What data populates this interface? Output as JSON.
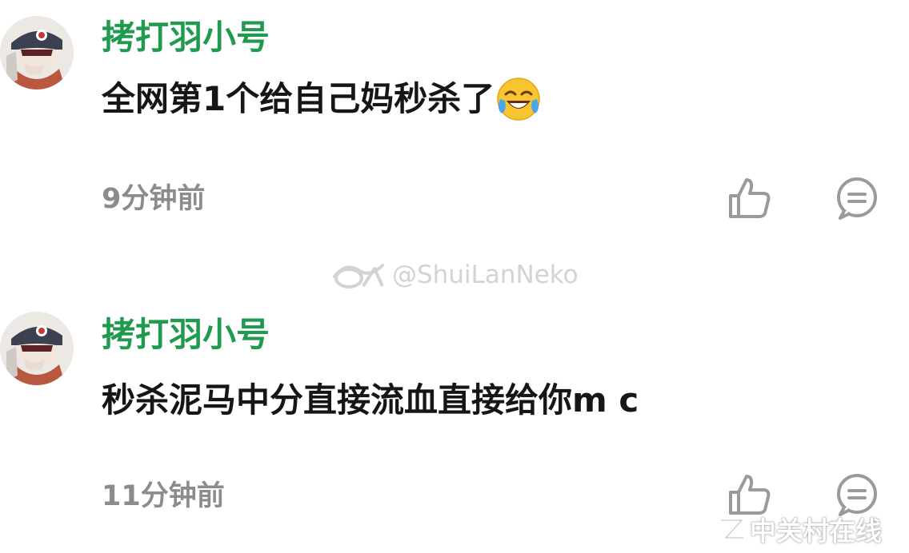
{
  "comments": [
    {
      "username": "拷打羽小号",
      "text": "全网第1个给自己妈秒杀了",
      "emoji": "laughing-tears-emoji",
      "time": "9分钟前"
    },
    {
      "username": "拷打羽小号",
      "text": "秒杀泥马中分直接流血直接给你m c",
      "time": "11分钟前"
    }
  ],
  "watermark": {
    "handle": "@ShuiLanNeko",
    "icon": "weibo-eye-icon"
  },
  "site_watermark": {
    "text": "中关村在线",
    "icon": "zol-logo-icon"
  },
  "icons": {
    "like": "thumbs-up-icon",
    "reply": "reply-bubble-icon"
  },
  "colors": {
    "username": "#1f9a4e",
    "text": "#161616",
    "time": "#8c8c8c",
    "icon": "#9a9a9a"
  }
}
